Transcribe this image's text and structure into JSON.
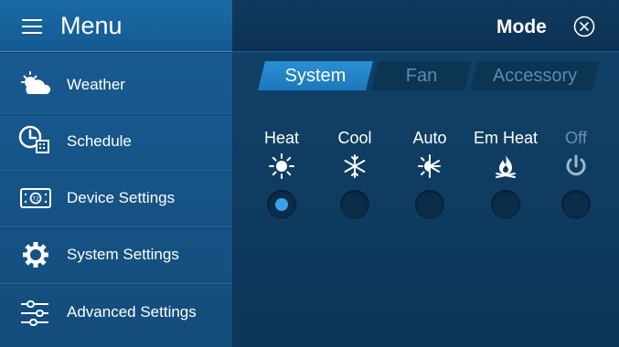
{
  "menu": {
    "title": "Menu",
    "items": [
      {
        "label": "Weather",
        "icon": "weather-icon"
      },
      {
        "label": "Schedule",
        "icon": "schedule-icon"
      },
      {
        "label": "Device Settings",
        "icon": "device-settings-icon"
      },
      {
        "label": "System Settings",
        "icon": "gear-icon"
      },
      {
        "label": "Advanced Settings",
        "icon": "sliders-icon"
      }
    ]
  },
  "mode_panel": {
    "title": "Mode",
    "tabs": [
      {
        "label": "System",
        "active": true
      },
      {
        "label": "Fan",
        "active": false
      },
      {
        "label": "Accessory",
        "active": false
      }
    ],
    "options": [
      {
        "label": "Heat",
        "icon": "sun-icon",
        "selected": true
      },
      {
        "label": "Cool",
        "icon": "snowflake-icon",
        "selected": false
      },
      {
        "label": "Auto",
        "icon": "auto-sun-snowflake-icon",
        "selected": false
      },
      {
        "label": "Em Heat",
        "icon": "flame-icon",
        "selected": false
      },
      {
        "label": "Off",
        "icon": "power-icon",
        "selected": false
      }
    ]
  },
  "colors": {
    "accent": "#2a8fd4",
    "selected_dot": "#3aa2ea",
    "sidebar_bg": "#165487",
    "panel_bg": "#0f3c61",
    "inactive_text": "#5f89ad"
  }
}
